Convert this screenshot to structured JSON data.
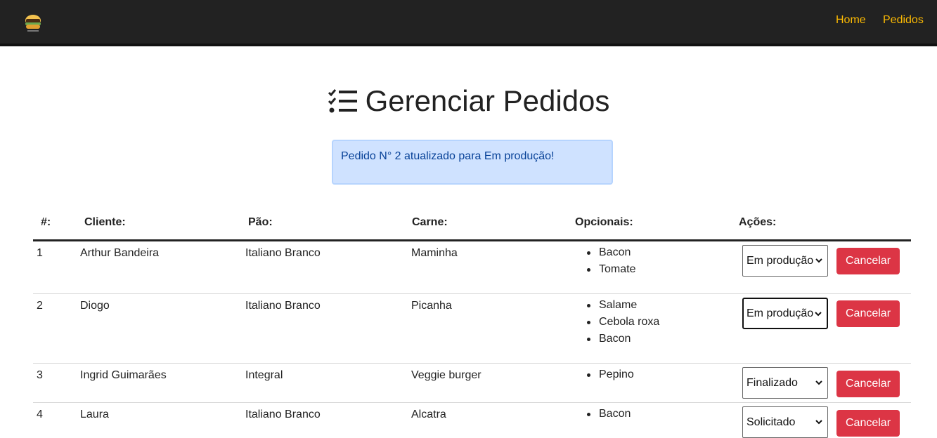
{
  "nav": {
    "home": "Home",
    "orders": "Pedidos"
  },
  "page": {
    "title": "Gerenciar Pedidos"
  },
  "alert": {
    "message": "Pedido N° 2 atualizado para Em produção!"
  },
  "table": {
    "headers": [
      "#:",
      "Cliente:",
      "Pão:",
      "Carne:",
      "Opcionais:",
      "Ações:"
    ],
    "rows": [
      {
        "id": "1",
        "client": "Arthur Bandeira",
        "bread": "Italiano Branco",
        "meat": "Maminha",
        "options": [
          "Bacon",
          "Tomate"
        ],
        "status": "Em produção",
        "cancel": "Cancelar"
      },
      {
        "id": "2",
        "client": "Diogo",
        "bread": "Italiano Branco",
        "meat": "Picanha",
        "options": [
          "Salame",
          "Cebola roxa",
          "Bacon"
        ],
        "status": "Em produção",
        "cancel": "Cancelar"
      },
      {
        "id": "3",
        "client": "Ingrid Guimarães",
        "bread": "Integral",
        "meat": "Veggie burger",
        "options": [
          "Pepino"
        ],
        "status": "Finalizado",
        "cancel": "Cancelar"
      },
      {
        "id": "4",
        "client": "Laura",
        "bread": "Italiano Branco",
        "meat": "Alcatra",
        "options": [
          "Bacon"
        ],
        "status": "Solicitado",
        "cancel": "Cancelar"
      }
    ]
  },
  "colors": {
    "navbar": "#222222",
    "navLink": "#FCBA03",
    "cancel": "#dc3545",
    "alertBg": "#cfe2ff",
    "alertText": "#084298"
  }
}
